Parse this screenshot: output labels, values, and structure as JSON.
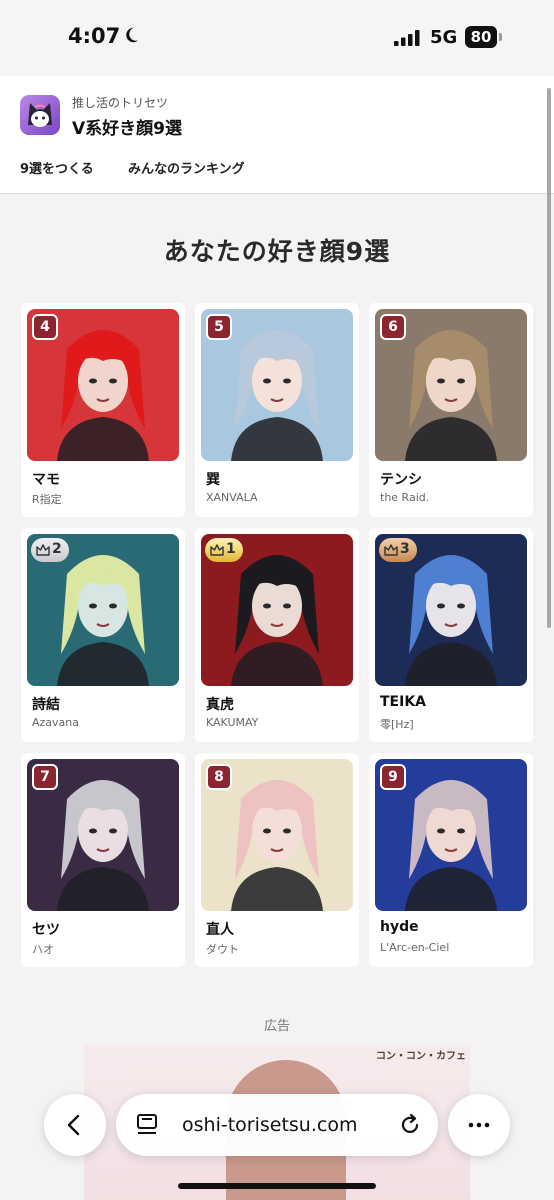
{
  "status_bar": {
    "time": "4:07",
    "network": "5G",
    "battery": "80"
  },
  "header": {
    "subtitle": "推し活のトリセツ",
    "title": "V系好き顔9選",
    "nav": [
      "9選をつくる",
      "みんなのランキング"
    ]
  },
  "page_title": "あなたの好き顔9選",
  "cards": [
    {
      "rank": "4",
      "crown": "",
      "name": "マモ",
      "band": "R指定",
      "palette": {
        "bg": "#d6353a",
        "hair": "#e01a1a",
        "skin": "#f1d5cc"
      }
    },
    {
      "rank": "5",
      "crown": "",
      "name": "巽",
      "band": "XANVALA",
      "palette": {
        "bg": "#a9c7de",
        "hair": "#b9c9dc",
        "skin": "#f3e1da"
      }
    },
    {
      "rank": "6",
      "crown": "",
      "name": "テンシ",
      "band": "the Raid.",
      "palette": {
        "bg": "#8a7a6c",
        "hair": "#a68c6a",
        "skin": "#eed7c9"
      }
    },
    {
      "rank": "2",
      "crown": "silver",
      "name": "詩結",
      "band": "Azavana",
      "palette": {
        "bg": "#2a6a74",
        "hair": "#d9e7a3",
        "skin": "#d8e6e3"
      }
    },
    {
      "rank": "1",
      "crown": "gold",
      "name": "真虎",
      "band": "KAKUMAY",
      "palette": {
        "bg": "#8c1a1f",
        "hair": "#1a1a1f",
        "skin": "#eadbd4"
      }
    },
    {
      "rank": "3",
      "crown": "bronze",
      "name": "TEIKA",
      "band": "零[Hz]",
      "palette": {
        "bg": "#1d2c57",
        "hair": "#4f7fd0",
        "skin": "#e6e3ea"
      }
    },
    {
      "rank": "7",
      "crown": "",
      "name": "セツ",
      "band": "ハオ",
      "palette": {
        "bg": "#3b2a44",
        "hair": "#c6c6cc",
        "skin": "#e9dfe3"
      }
    },
    {
      "rank": "8",
      "crown": "",
      "name": "直人",
      "band": "ダウト",
      "palette": {
        "bg": "#ece2c9",
        "hair": "#eec2c0",
        "skin": "#f3dfd7"
      }
    },
    {
      "rank": "9",
      "crown": "",
      "name": "hyde",
      "band": "L'Arc-en-Ciel",
      "palette": {
        "bg": "#243c9a",
        "hair": "#c8b9c2",
        "skin": "#efd9d3"
      }
    }
  ],
  "ad": {
    "label": "広告",
    "brand": "コン・コン・カフェ"
  },
  "browser": {
    "url": "oshi-torisetsu.com"
  },
  "icons": [
    "moon-icon",
    "signal-icon",
    "app-logo-icon",
    "crown-icon",
    "back-icon",
    "reader-icon",
    "reload-icon",
    "more-icon"
  ]
}
